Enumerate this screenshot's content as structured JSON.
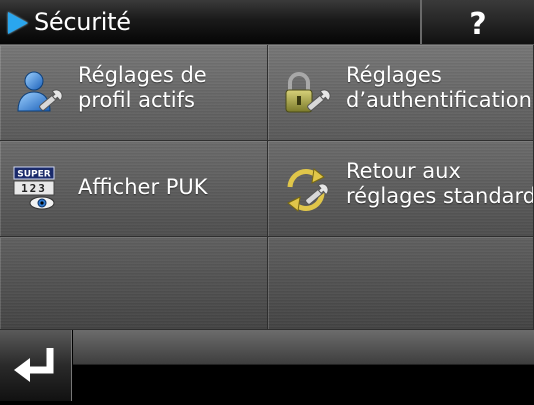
{
  "header": {
    "title": "Sécurité",
    "help_label": "?"
  },
  "menu": [
    {
      "label_line1": "Réglages de",
      "label_line2": "profil actifs",
      "icon": "user-wrench-icon"
    },
    {
      "label_line1": "Réglages",
      "label_line2": "d’authentification",
      "icon": "padlock-wrench-icon"
    },
    {
      "label_line1": "Afficher PUK",
      "label_line2": "",
      "icon": "super-pin-card-icon",
      "badge_text": "SUPER",
      "digits": "123"
    },
    {
      "label_line1": "Retour aux",
      "label_line2": "réglages standard",
      "icon": "reset-wrench-icon"
    }
  ],
  "colors": {
    "accent": "#2aa6ee",
    "background": "#000000"
  }
}
